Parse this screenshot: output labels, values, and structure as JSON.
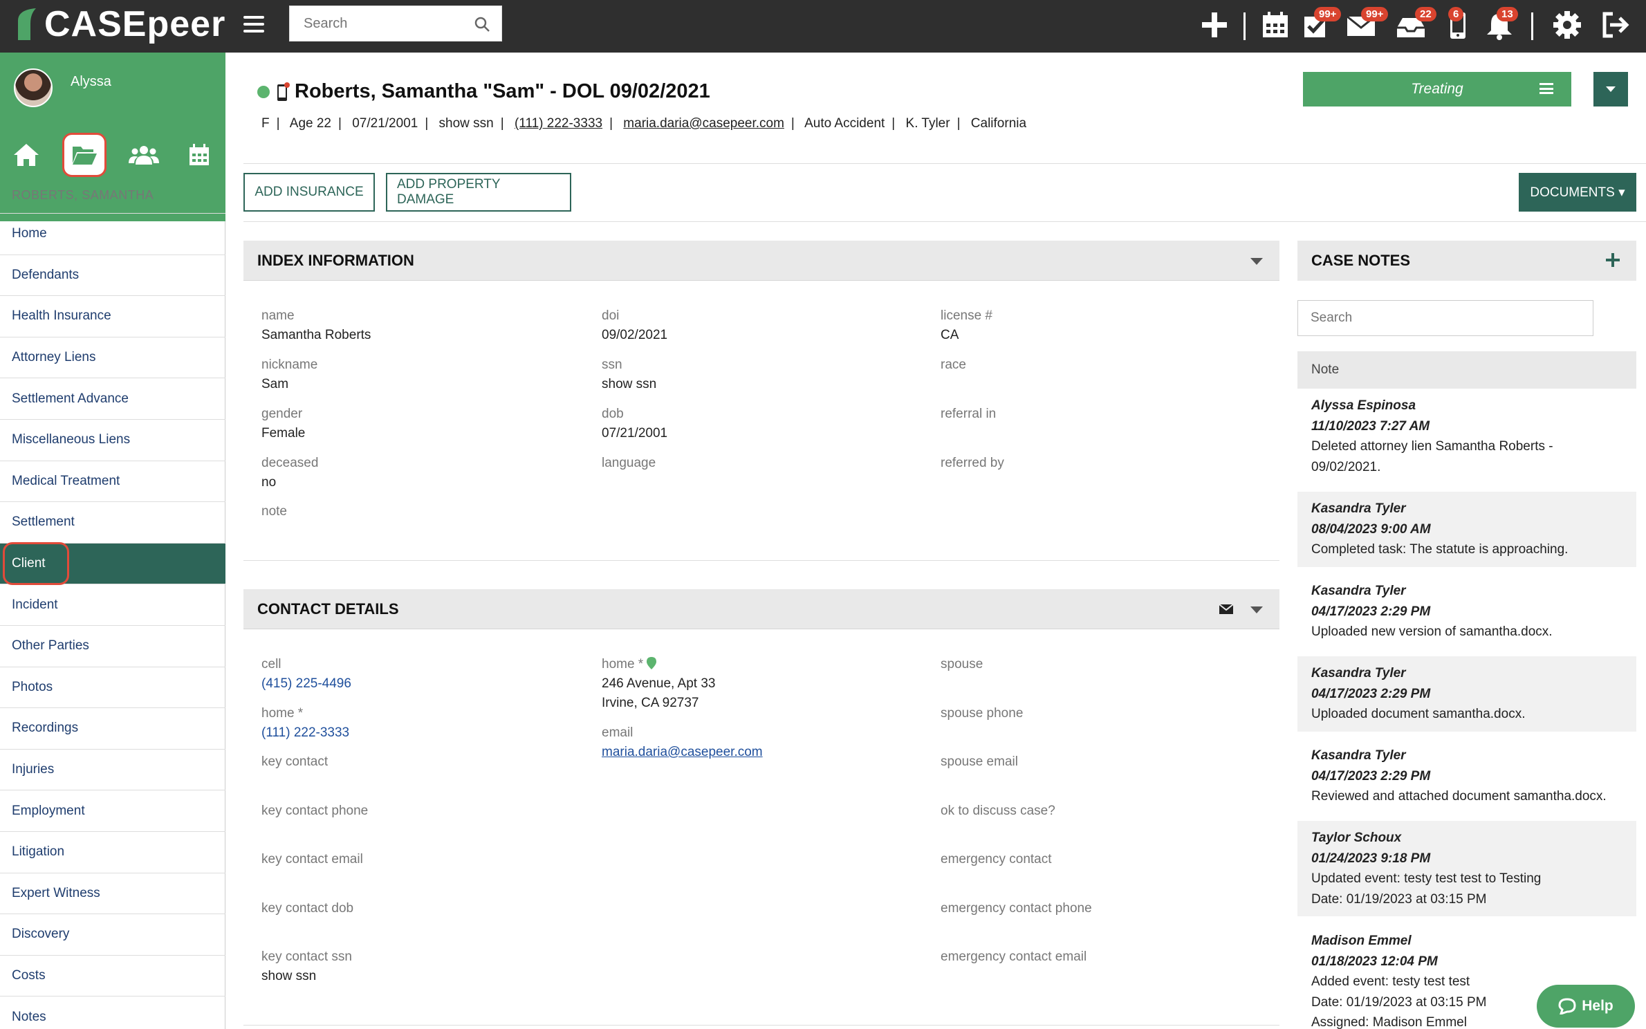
{
  "app": {
    "brand": "CASEpeer"
  },
  "topbar": {
    "search_placeholder": "Search",
    "badges": {
      "tasks": "99+",
      "mail": "99+",
      "inbox": "22",
      "phone": "6",
      "bell": "13"
    }
  },
  "sidebar": {
    "user_name": "Alyssa",
    "case_name": "ROBERTS, SAMANTHA",
    "items": [
      "Home",
      "Defendants",
      "Health Insurance",
      "Attorney Liens",
      "Settlement Advance",
      "Miscellaneous Liens",
      "Medical Treatment",
      "Settlement",
      "Client",
      "Incident",
      "Other Parties",
      "Photos",
      "Recordings",
      "Injuries",
      "Employment",
      "Litigation",
      "Expert Witness",
      "Discovery",
      "Costs",
      "Notes"
    ]
  },
  "case": {
    "title": "Roberts, Samantha \"Sam\" - DOL 09/02/2021",
    "meta": {
      "sex": "F",
      "age": "Age 22",
      "dob": "07/21/2001",
      "ssn": "show ssn",
      "phone": "(111) 222-3333",
      "email": "maria.daria@casepeer.com",
      "type": "Auto Accident",
      "attorney": "K. Tyler",
      "state": "California"
    },
    "status": "Treating"
  },
  "actions": {
    "add_insurance": "ADD INSURANCE",
    "add_property_damage": "ADD PROPERTY DAMAGE",
    "documents": "DOCUMENTS ▾"
  },
  "index_info": {
    "title": "INDEX INFORMATION",
    "fields": {
      "name_l": "name",
      "name_v": "Samantha Roberts",
      "nickname_l": "nickname",
      "nickname_v": "Sam",
      "gender_l": "gender",
      "gender_v": "Female",
      "deceased_l": "deceased",
      "deceased_v": "no",
      "note_l": "note",
      "doi_l": "doi",
      "doi_v": "09/02/2021",
      "ssn_l": "ssn",
      "ssn_v": "show ssn",
      "dob_l": "dob",
      "dob_v": "07/21/2001",
      "language_l": "language",
      "license_l": "license #",
      "license_v": "CA",
      "race_l": "race",
      "referral_in_l": "referral in",
      "referred_by_l": "referred by"
    }
  },
  "contact": {
    "title": "CONTACT DETAILS",
    "fields": {
      "cell_l": "cell",
      "cell_v": "(415) 225-4496",
      "home_phone_l": "home *",
      "home_phone_v": "(111) 222-3333",
      "key_contact_l": "key contact",
      "key_contact_phone_l": "key contact phone",
      "key_contact_email_l": "key contact email",
      "key_contact_dob_l": "key contact dob",
      "key_contact_ssn_l": "key contact ssn",
      "key_contact_ssn_v": "show ssn",
      "home_addr_l": "home *",
      "home_addr_1": "246 Avenue, Apt 33",
      "home_addr_2": "Irvine, CA 92737",
      "email_l": "email",
      "email_v": "maria.daria@casepeer.com",
      "spouse_l": "spouse",
      "spouse_phone_l": "spouse phone",
      "spouse_email_l": "spouse email",
      "ok_discuss_l": "ok to discuss case?",
      "emergency_contact_l": "emergency contact",
      "emergency_phone_l": "emergency contact phone",
      "emergency_email_l": "emergency contact email"
    }
  },
  "notes": {
    "title": "CASE NOTES",
    "search_placeholder": "Search",
    "column": "Note",
    "items": [
      {
        "author": "Alyssa Espinosa",
        "date": "11/10/2023 7:27 AM",
        "text": [
          "Deleted attorney lien Samantha Roberts -",
          "09/02/2021."
        ]
      },
      {
        "author": "Kasandra Tyler",
        "date": "08/04/2023 9:00 AM",
        "text": [
          "Completed task: The statute is approaching."
        ]
      },
      {
        "author": "Kasandra Tyler",
        "date": "04/17/2023 2:29 PM",
        "text": [
          "Uploaded new version of samantha.docx."
        ]
      },
      {
        "author": "Kasandra Tyler",
        "date": "04/17/2023 2:29 PM",
        "text": [
          "Uploaded document samantha.docx."
        ]
      },
      {
        "author": "Kasandra Tyler",
        "date": "04/17/2023 2:29 PM",
        "text": [
          "Reviewed and attached document samantha.docx."
        ]
      },
      {
        "author": "Taylor Schoux",
        "date": "01/24/2023 9:18 PM",
        "text": [
          "Updated event: testy test test to Testing",
          "Date: 01/19/2023 at 03:15 PM"
        ]
      },
      {
        "author": "Madison Emmel",
        "date": "01/18/2023 12:04 PM",
        "text": [
          "Added event: testy test test",
          "Date: 01/19/2023 at 03:15 PM",
          "Assigned: Madison Emmel"
        ]
      }
    ]
  },
  "help": {
    "label": "Help"
  },
  "colors": {
    "topbar": "#2f2f2f",
    "brand_green": "#4ea467",
    "dark_teal": "#2d6558",
    "badge_red": "#d9442f",
    "highlight": "#e14b3a"
  }
}
